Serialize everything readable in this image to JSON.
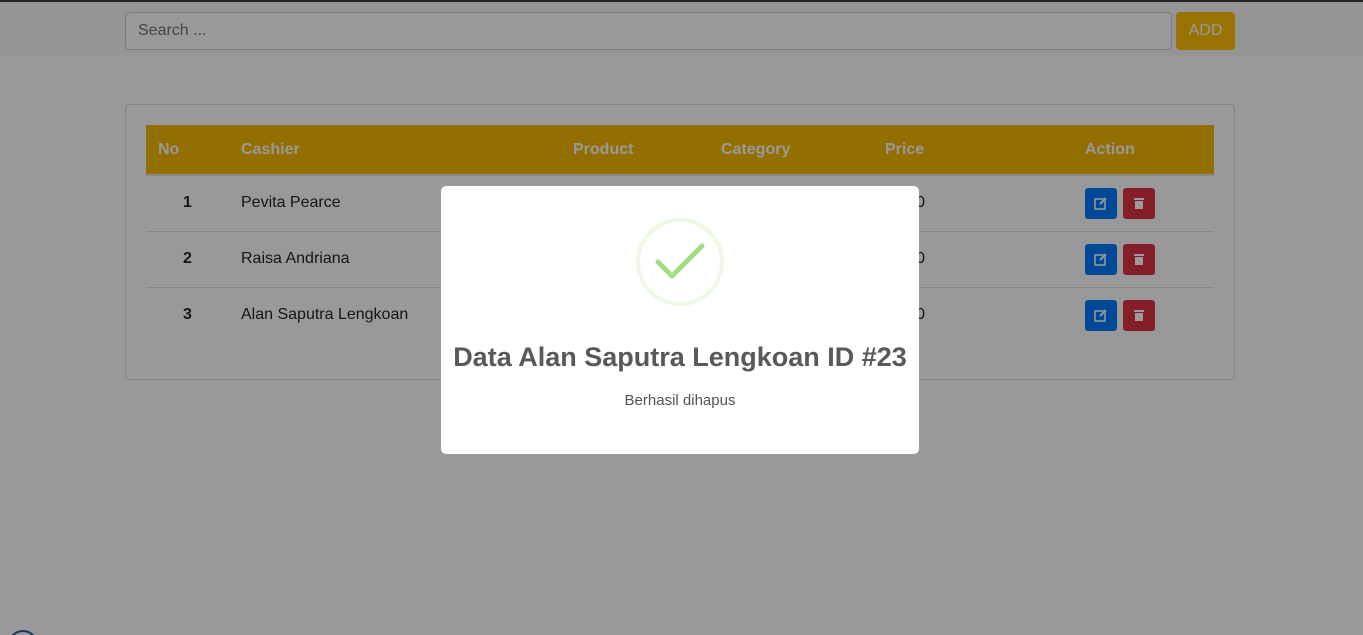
{
  "search": {
    "placeholder": "Search ..."
  },
  "add_label": "ADD",
  "table": {
    "headers": [
      "No",
      "Cashier",
      "Product",
      "Category",
      "Price",
      "Action"
    ],
    "rows": [
      {
        "no": "1",
        "cashier": "Pevita Pearce",
        "product": "",
        "category": "",
        "price": "0,000"
      },
      {
        "no": "2",
        "cashier": "Raisa Andriana",
        "product": "",
        "category": "",
        "price": "0,000"
      },
      {
        "no": "3",
        "cashier": "Alan Saputra Lengkoan",
        "product": "",
        "category": "",
        "price": "0,000"
      }
    ]
  },
  "modal": {
    "icon": "success-check-icon",
    "title": "Data Alan Saputra Lengkoan ID #23",
    "text": "Berhasil dihapus"
  },
  "colors": {
    "header": "#f6b700",
    "add_button": "#ffc107",
    "edit_button": "#007bff",
    "delete_button": "#dc3545",
    "check": "#a5dc86"
  }
}
